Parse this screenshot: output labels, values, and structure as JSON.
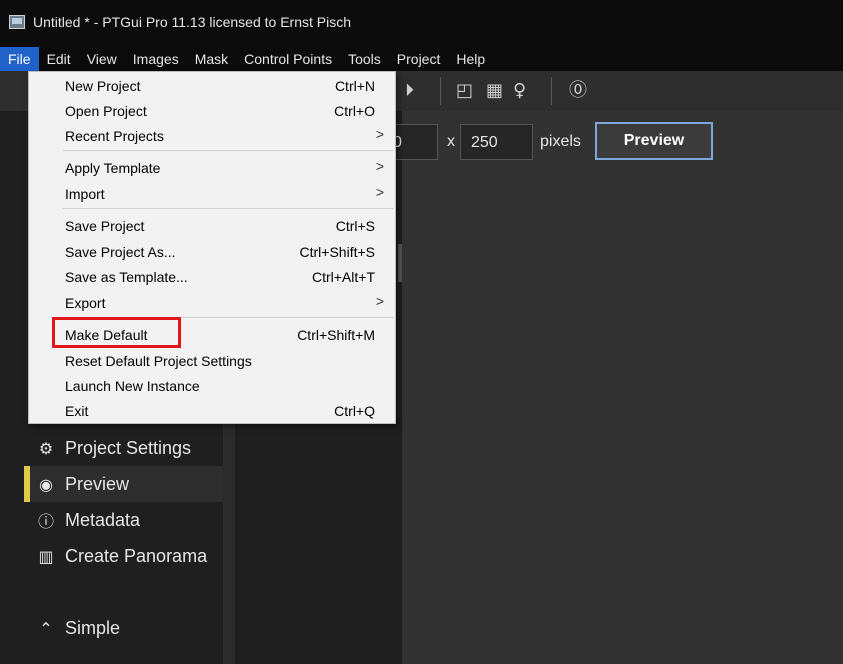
{
  "window": {
    "title": "Untitled * - PTGui Pro 11.13 licensed to Ernst Pisch"
  },
  "menubar": [
    {
      "label": "File",
      "active": true
    },
    {
      "label": "Edit"
    },
    {
      "label": "View"
    },
    {
      "label": "Images"
    },
    {
      "label": "Mask"
    },
    {
      "label": "Control Points"
    },
    {
      "label": "Tools"
    },
    {
      "label": "Project"
    },
    {
      "label": "Help"
    }
  ],
  "toolbar": {
    "icons": [
      "play-forward-icon",
      "panorama-editor-icon",
      "table-icon",
      "lightbulb-icon",
      "help-icon"
    ]
  },
  "preview_size": {
    "width_value": "0",
    "height_prefix": "x",
    "height_value": "250",
    "unit": "pixels",
    "button": "Preview"
  },
  "sidebar": {
    "items": [
      {
        "label": "Project Settings",
        "icon": "gear-icon"
      },
      {
        "label": "Preview",
        "icon": "eye-icon",
        "selected": true
      },
      {
        "label": "Metadata",
        "icon": "info-icon"
      },
      {
        "label": "Create Panorama",
        "icon": "panorama-icon"
      },
      {
        "label": "Simple",
        "icon": "chevron-up-circle-icon"
      }
    ],
    "accent_color": "#e4c84a"
  },
  "file_menu": {
    "items": [
      {
        "label": "New Project",
        "shortcut": "Ctrl+N"
      },
      {
        "label": "Open Project",
        "shortcut": "Ctrl+O"
      },
      {
        "label": "Recent Projects",
        "submenu": true
      },
      {
        "label": "Apply Template",
        "submenu": true
      },
      {
        "label": "Import",
        "submenu": true
      },
      {
        "label": "Save Project",
        "shortcut": "Ctrl+S"
      },
      {
        "label": "Save Project As...",
        "shortcut": "Ctrl+Shift+S"
      },
      {
        "label": "Save as Template...",
        "shortcut": "Ctrl+Alt+T"
      },
      {
        "label": "Export",
        "submenu": true
      },
      {
        "label": "Make Default",
        "shortcut": "Ctrl+Shift+M",
        "highlighted": true
      },
      {
        "label": "Reset Default Project Settings"
      },
      {
        "label": "Launch New Instance"
      },
      {
        "label": "Exit",
        "shortcut": "Ctrl+Q"
      }
    ],
    "submenu_glyph": ">",
    "highlight_color": "#e3161a"
  },
  "colors": {
    "menu_active": "#1f62c9",
    "preview_border": "#7fa6d9"
  }
}
